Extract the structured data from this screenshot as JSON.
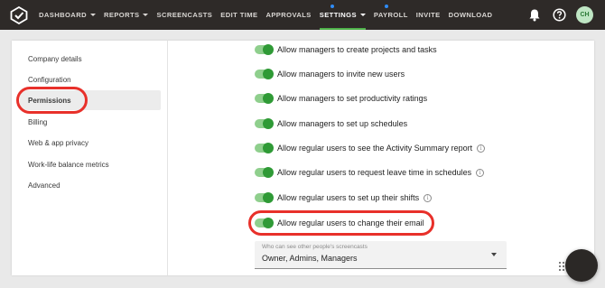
{
  "nav": {
    "items": [
      {
        "label": "DASHBOARD",
        "caret": true
      },
      {
        "label": "REPORTS",
        "caret": true
      },
      {
        "label": "SCREENCASTS",
        "caret": false
      },
      {
        "label": "EDIT TIME",
        "caret": false
      },
      {
        "label": "APPROVALS",
        "caret": false
      },
      {
        "label": "SETTINGS",
        "caret": true,
        "active": true,
        "dot": true
      },
      {
        "label": "PAYROLL",
        "caret": false,
        "dot": true
      },
      {
        "label": "INVITE",
        "caret": false
      },
      {
        "label": "DOWNLOAD",
        "caret": false
      }
    ],
    "icons": [
      "logo-icon",
      "bell-icon",
      "help-icon"
    ],
    "avatar_initials": "CH",
    "colors": {
      "bar": "#2e2a28",
      "active_underline": "#4fb24a",
      "dot": "#2f8cf7"
    }
  },
  "sidebar": {
    "items": [
      {
        "label": "Company details"
      },
      {
        "label": "Configuration"
      },
      {
        "label": "Permissions",
        "active": true,
        "highlighted": true
      },
      {
        "label": "Billing"
      },
      {
        "label": "Web & app privacy"
      },
      {
        "label": "Work-life balance metrics"
      },
      {
        "label": "Advanced"
      }
    ]
  },
  "permissions": [
    {
      "label": "Allow managers to create projects and tasks",
      "enabled": true,
      "info": false
    },
    {
      "label": "Allow managers to invite new users",
      "enabled": true,
      "info": false
    },
    {
      "label": "Allow managers to set productivity ratings",
      "enabled": true,
      "info": false
    },
    {
      "label": "Allow managers to set up schedules",
      "enabled": true,
      "info": false
    },
    {
      "label": "Allow regular users to see the Activity Summary report",
      "enabled": true,
      "info": true
    },
    {
      "label": "Allow regular users to request leave time in schedules",
      "enabled": true,
      "info": true
    },
    {
      "label": "Allow regular users to set up their shifts",
      "enabled": true,
      "info": true
    },
    {
      "label": "Allow regular users to change their email",
      "enabled": true,
      "info": false,
      "highlighted": true
    }
  ],
  "screencast_select": {
    "label": "Who can see other people's screencasts",
    "value": "Owner, Admins, Managers"
  },
  "highlight_color": "#e8302a",
  "toggle_color": "#2f9a36"
}
